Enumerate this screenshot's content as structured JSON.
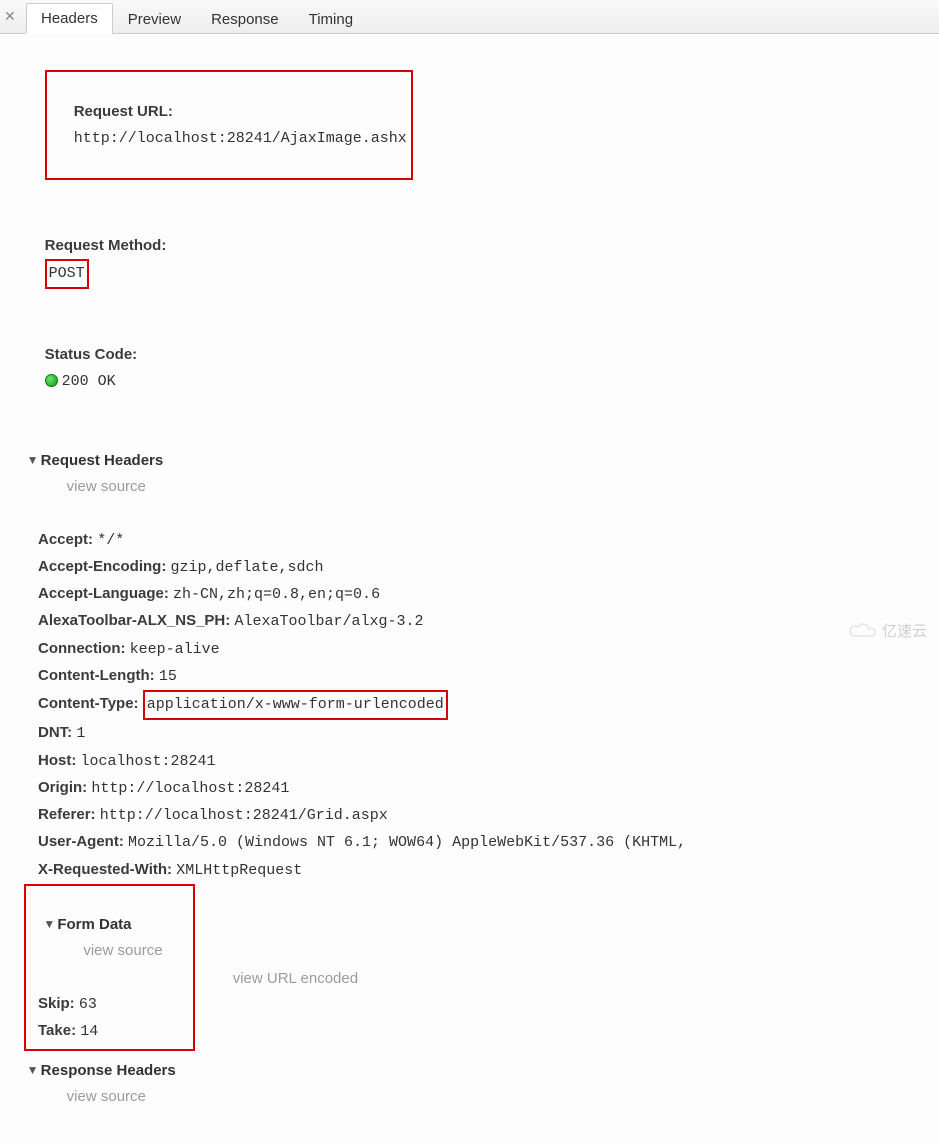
{
  "tabs": {
    "headers": "Headers",
    "preview": "Preview",
    "response": "Response",
    "timing": "Timing"
  },
  "general": {
    "requestUrlLabel": "Request URL:",
    "requestUrlValue": "http://localhost:28241/AjaxImage.ashx",
    "requestMethodLabel": "Request Method:",
    "requestMethodValue": "POST",
    "statusCodeLabel": "Status Code:",
    "statusCodeValue": "200 OK"
  },
  "requestHeaders": {
    "title": "Request Headers",
    "viewSource": "view source",
    "items": {
      "accept": {
        "k": "Accept:",
        "v": "*/*"
      },
      "acceptEncoding": {
        "k": "Accept-Encoding:",
        "v": "gzip,deflate,sdch"
      },
      "acceptLanguage": {
        "k": "Accept-Language:",
        "v": "zh-CN,zh;q=0.8,en;q=0.6"
      },
      "alexa": {
        "k": "AlexaToolbar-ALX_NS_PH:",
        "v": "AlexaToolbar/alxg-3.2"
      },
      "connection": {
        "k": "Connection:",
        "v": "keep-alive"
      },
      "contentLength": {
        "k": "Content-Length:",
        "v": "15"
      },
      "contentType": {
        "k": "Content-Type:",
        "v": "application/x-www-form-urlencoded"
      },
      "dnt": {
        "k": "DNT:",
        "v": "1"
      },
      "host": {
        "k": "Host:",
        "v": "localhost:28241"
      },
      "origin": {
        "k": "Origin:",
        "v": "http://localhost:28241"
      },
      "referer": {
        "k": "Referer:",
        "v": "http://localhost:28241/Grid.aspx"
      },
      "userAgent": {
        "k": "User-Agent:",
        "v": "Mozilla/5.0 (Windows NT 6.1; WOW64) AppleWebKit/537.36 (KHTML,"
      },
      "xRequestedWith": {
        "k": "X-Requested-With:",
        "v": "XMLHttpRequest"
      }
    }
  },
  "formData": {
    "title": "Form Data",
    "viewSource": "view source",
    "viewUrlEncoded": "view URL encoded",
    "items": {
      "skip": {
        "k": "Skip:",
        "v": "63"
      },
      "take": {
        "k": "Take:",
        "v": "14"
      }
    }
  },
  "responseHeaders": {
    "title": "Response Headers",
    "viewSource": "view source"
  },
  "watermark": "亿速云"
}
